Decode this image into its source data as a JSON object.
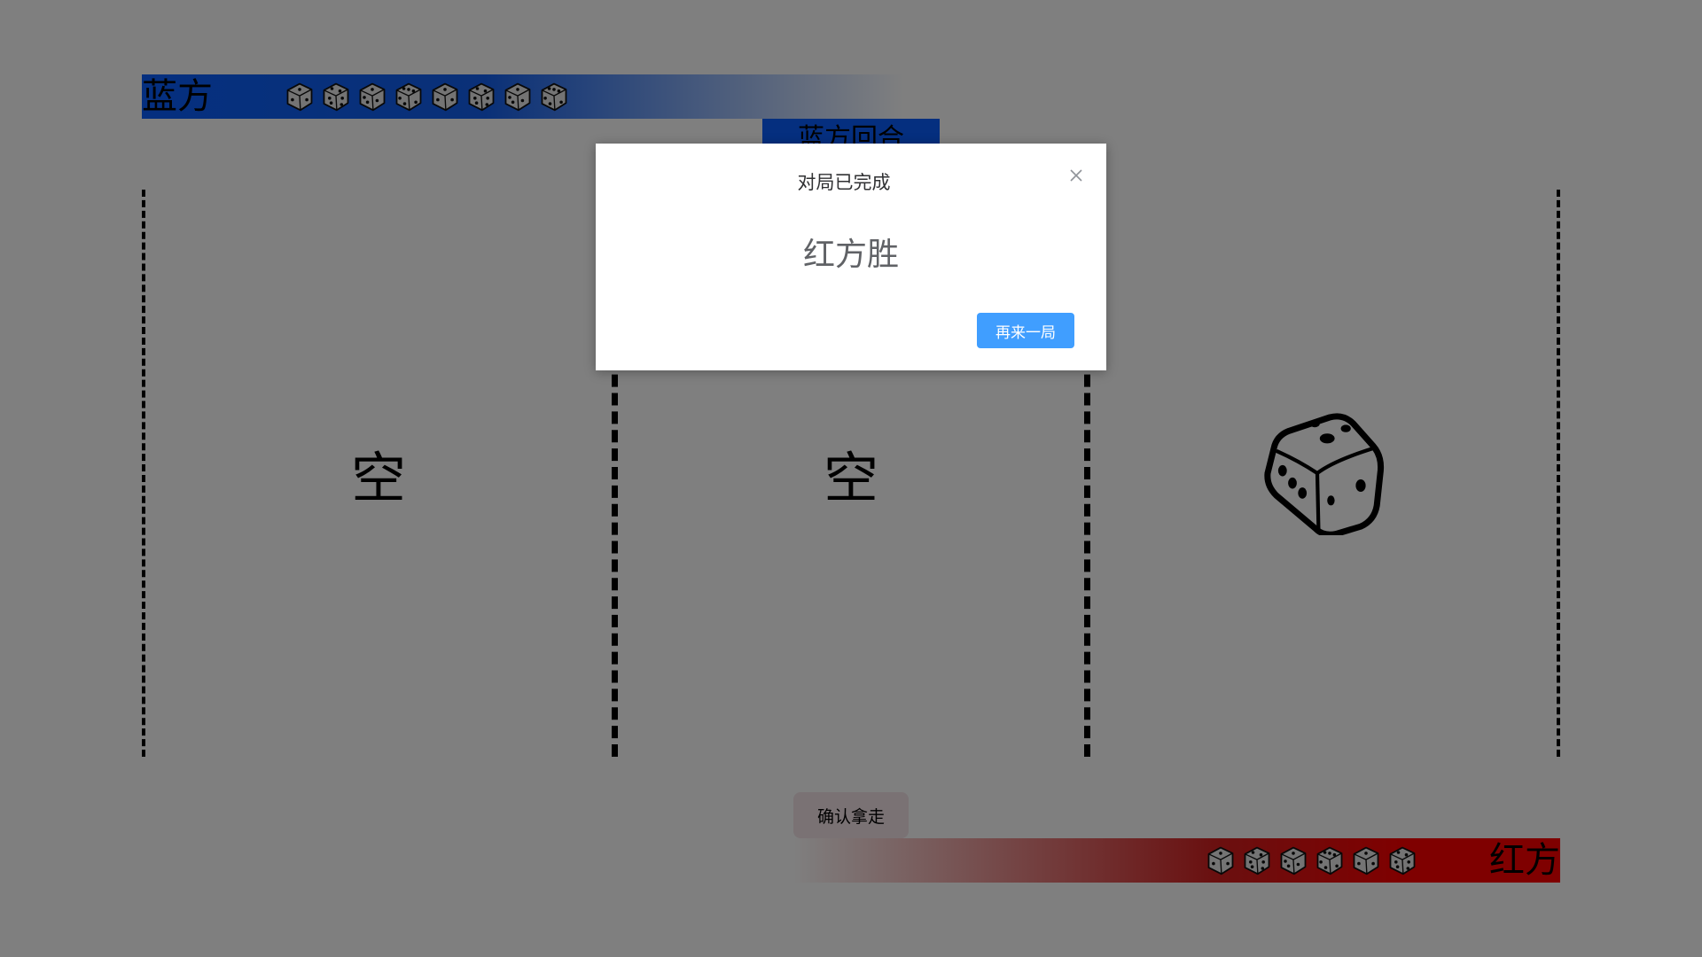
{
  "players": {
    "blue": {
      "name": "蓝方",
      "color": "#0a5fff",
      "remaining_dice": 8
    },
    "red": {
      "name": "红方",
      "color": "#ff0000",
      "remaining_dice": 6
    }
  },
  "turn": {
    "label": "蓝方回合"
  },
  "slots": [
    {
      "state": "empty",
      "label": "空"
    },
    {
      "state": "empty",
      "label": "空"
    },
    {
      "state": "die",
      "icon": "die-icon"
    }
  ],
  "actions": {
    "take_label": "确认拿走"
  },
  "modal": {
    "title": "对局已完成",
    "message": "红方胜",
    "again_label": "再来一局",
    "close_icon": "close-icon"
  },
  "colors": {
    "overlay": "rgba(0,0,0,0.5)",
    "primary_button": "#409eff"
  }
}
